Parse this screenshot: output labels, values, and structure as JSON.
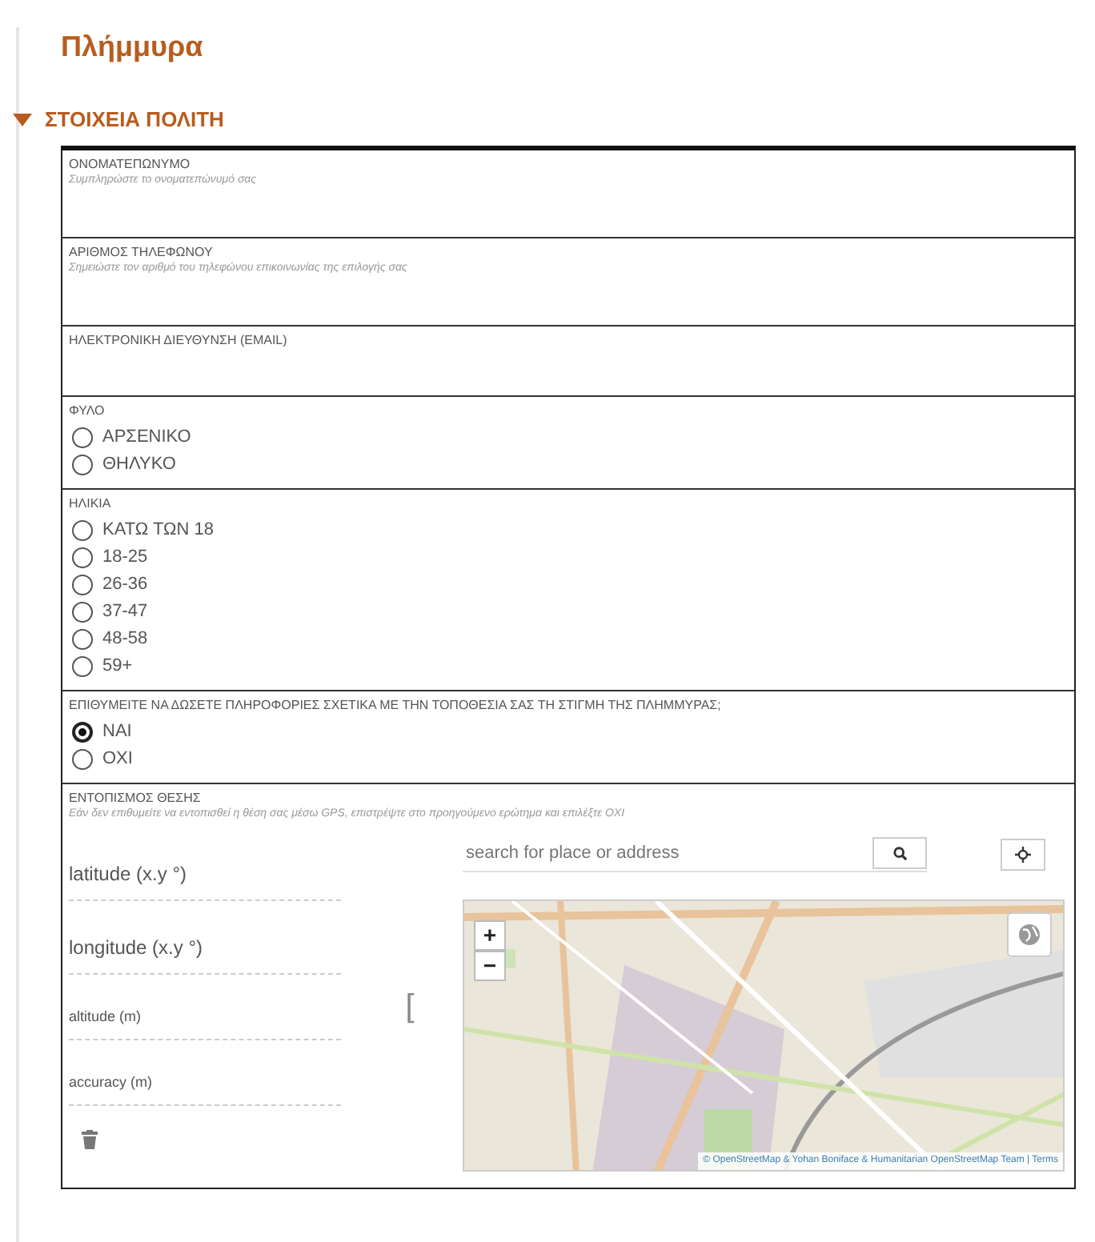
{
  "title": "Πλήμμυρα",
  "section": {
    "label": "ΣΤΟΙΧΕΙΑ ΠΟΛΙΤΗ",
    "expanded": true
  },
  "fields": [
    {
      "kind": "text",
      "label": "ΟΝΟΜΑΤΕΠΩΝΥΜΟ",
      "hint": "Συμπληρώστε το ονοματεπώνυμό σας"
    },
    {
      "kind": "text",
      "label": "ΑΡΙΘΜΟΣ ΤΗΛΕΦΩΝΟΥ",
      "hint": "Σημειώστε τον αριθμό του τηλεφώνου επικοινωνίας της επιλογής σας"
    },
    {
      "kind": "text",
      "label": "ΗΛΕΚΤΡΟΝΙΚΗ ΔΙΕΥΘΥΝΣΗ (EMAIL)"
    },
    {
      "kind": "radio",
      "label": "ΦΥΛΟ",
      "options": [
        {
          "label": "ΑΡΣΕΝΙΚΟ",
          "selected": false
        },
        {
          "label": "ΘΗΛΥΚΟ",
          "selected": false
        }
      ]
    },
    {
      "kind": "radio",
      "label": "ΗΛΙΚΙΑ",
      "options": [
        {
          "label": "ΚΑΤΩ ΤΩΝ 18",
          "selected": false
        },
        {
          "label": "18-25",
          "selected": false
        },
        {
          "label": "26-36",
          "selected": false
        },
        {
          "label": "37-47",
          "selected": false
        },
        {
          "label": "48-58",
          "selected": false
        },
        {
          "label": "59+",
          "selected": false
        }
      ]
    },
    {
      "kind": "radio",
      "label": "ΕΠΙΘΥΜΕΙΤΕ ΝΑ ΔΩΣΕΤΕ ΠΛΗΡΟΦΟΡΙΕΣ ΣΧΕΤΙΚΑ ΜΕ ΤΗΝ ΤΟΠΟΘΕΣΙΑ ΣΑΣ ΤΗ ΣΤΙΓΜΗ ΤΗΣ ΠΛΗΜΜΥΡΑΣ;",
      "options": [
        {
          "label": "ΝΑΙ",
          "selected": true
        },
        {
          "label": "ΟΧΙ",
          "selected": false
        }
      ]
    },
    {
      "kind": "location",
      "label": "ΕΝΤΟΠΙΣΜΟΣ ΘΕΣΗΣ",
      "hint": "Εάν δεν επιθυμείτε να εντοπισθεί η θέση σας μέσω GPS, επιστρέψτε στο προηγούμενο ερώτημα και επιλέξτε ΟΧΙ",
      "coords": [
        {
          "placeholder": "latitude (x.y °)",
          "kind": "coordinate"
        },
        {
          "placeholder": "longitude (x.y °)",
          "kind": "coordinate"
        },
        {
          "placeholder": "altitude (m)",
          "kind": "measurement"
        },
        {
          "placeholder": "accuracy (m)",
          "kind": "measurement"
        }
      ],
      "bracket": "[",
      "search": {
        "placeholder": "search for place or address"
      },
      "map": {
        "zoom_in": "+",
        "zoom_out": "−",
        "attribution": "© OpenStreetMap & Yohan Boniface & Humanitarian OpenStreetMap Team | Terms"
      }
    }
  ]
}
